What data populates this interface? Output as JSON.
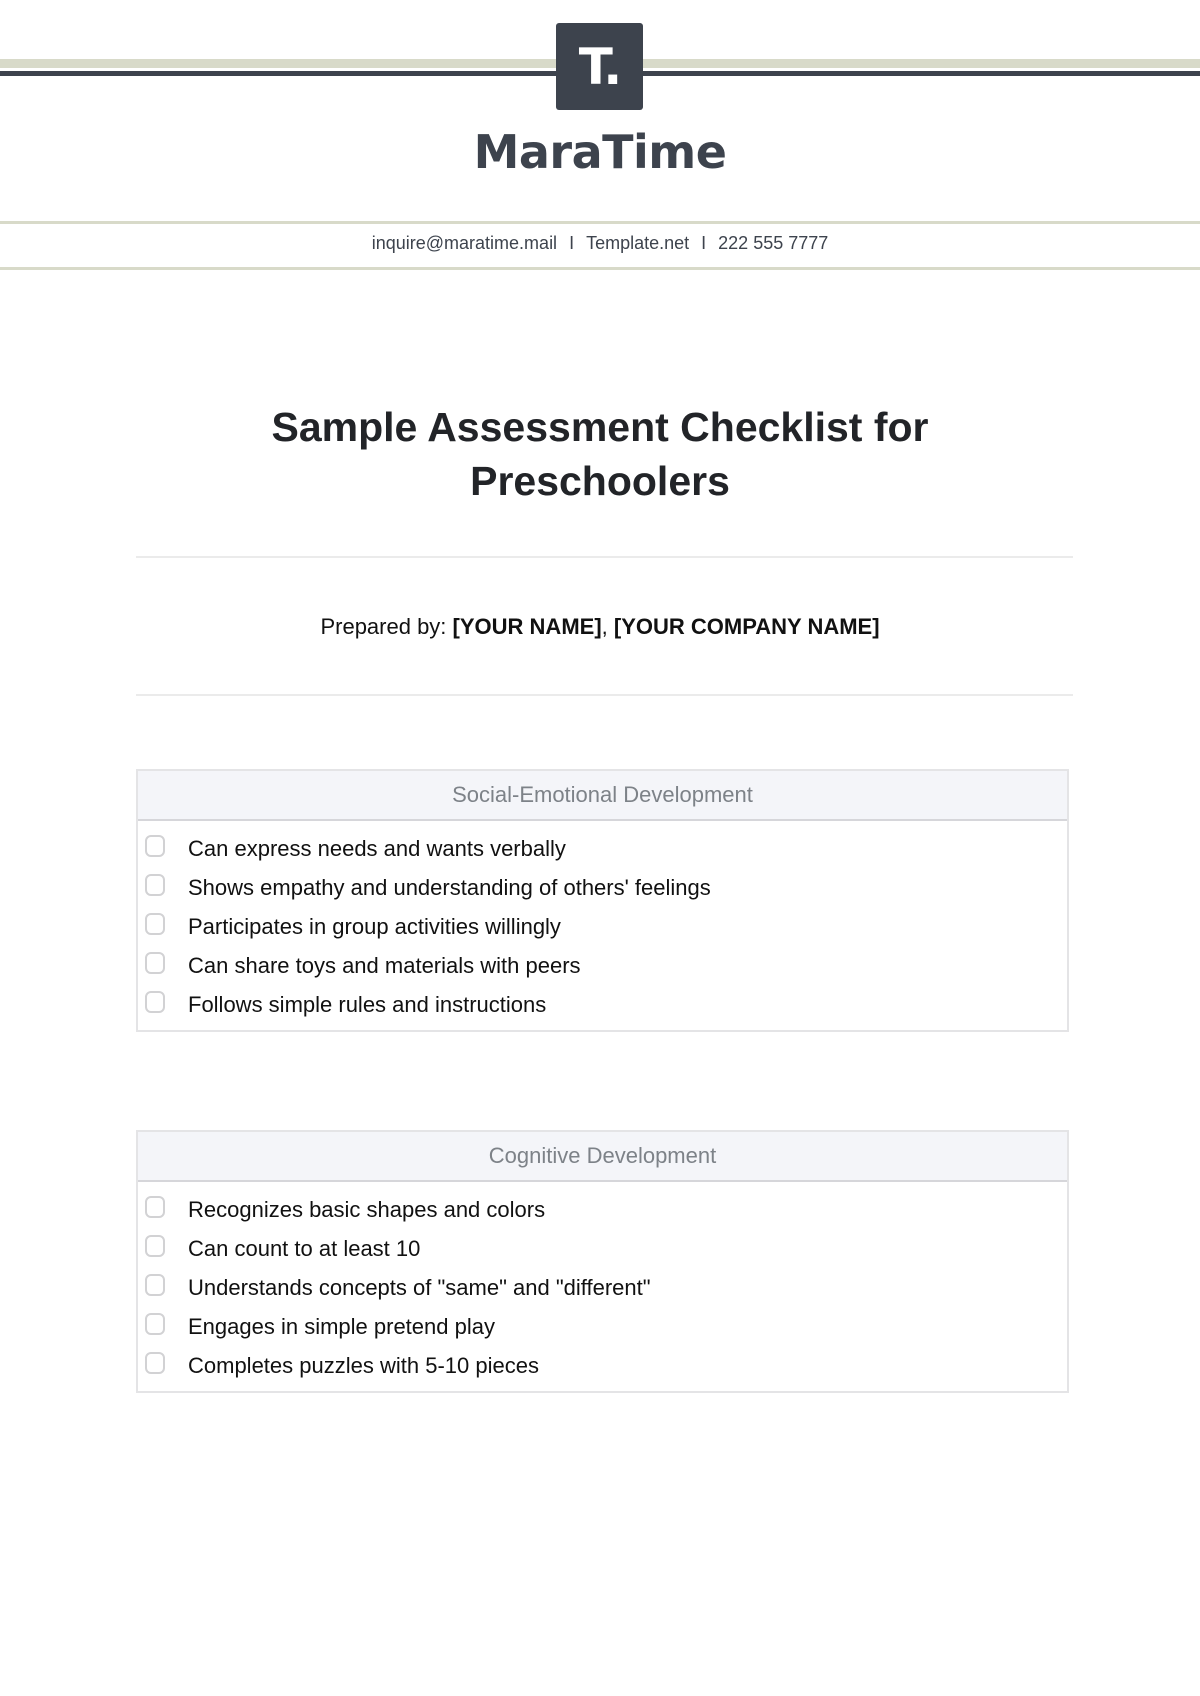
{
  "header": {
    "logo_glyph": "T.",
    "brand": "MaraTime",
    "contact": {
      "email": "inquire@maratime.mail",
      "website": "Template.net",
      "phone": "222 555 7777",
      "separator": "I"
    }
  },
  "document": {
    "title": "Sample Assessment Checklist for Preschoolers",
    "prepared_by_label": "Prepared by:",
    "prepared_by_name": "[YOUR NAME]",
    "prepared_by_sep": ",",
    "prepared_by_company": "[YOUR COMPANY NAME]"
  },
  "sections": [
    {
      "title": "Social-Emotional Development",
      "items": [
        {
          "label": "Can express needs and wants verbally",
          "checked": false
        },
        {
          "label": "Shows empathy and understanding of others' feelings",
          "checked": false
        },
        {
          "label": "Participates in group activities willingly",
          "checked": false
        },
        {
          "label": "Can share toys and materials with peers",
          "checked": false
        },
        {
          "label": "Follows simple rules and instructions",
          "checked": false
        }
      ]
    },
    {
      "title": "Cognitive Development",
      "items": [
        {
          "label": "Recognizes basic shapes and colors",
          "checked": false
        },
        {
          "label": "Can count to at least 10",
          "checked": false
        },
        {
          "label": "Understands concepts of \"same\" and \"different\"",
          "checked": false
        },
        {
          "label": "Engages in simple pretend play",
          "checked": false
        },
        {
          "label": "Completes puzzles with 5-10 pieces",
          "checked": false
        }
      ]
    }
  ],
  "colors": {
    "brand_dark": "#3d434d",
    "accent_light": "#d8dac9",
    "section_header_bg": "#f4f5f9"
  }
}
